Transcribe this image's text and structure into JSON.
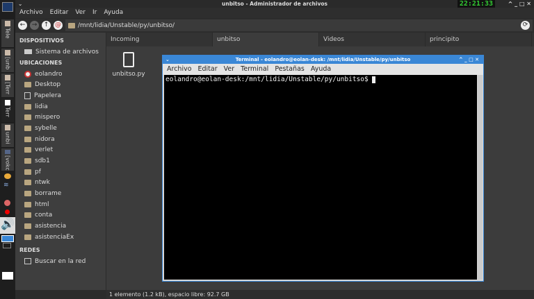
{
  "window": {
    "title": "unbitso - Administrador de archivos",
    "clock": "22:21:33"
  },
  "taskbar": {
    "items": [
      "Tele",
      "[unb",
      "[Terr",
      "Terr",
      "unbi",
      "[vokc"
    ]
  },
  "menu": [
    "Archivo",
    "Editar",
    "Ver",
    "Ir",
    "Ayuda"
  ],
  "toolbar": {
    "path": "/mnt/lidia/Unstable/py/unbitso/"
  },
  "sidebar": {
    "devices_title": "DISPOSITIVOS",
    "devices": [
      "Sistema de archivos"
    ],
    "places_title": "UBICACIONES",
    "places": [
      "eolandro",
      "Desktop",
      "Papelera",
      "lidia",
      "mispero",
      "sybelle",
      "nidora",
      "verlet",
      "sdb1",
      "pf",
      "ntwk",
      "borrame",
      "html",
      "conta",
      "asistencia",
      "asistenciaEx"
    ],
    "network_title": "REDES",
    "network": [
      "Buscar en la red"
    ]
  },
  "tabs": [
    "Incoming",
    "unbitso",
    "Videos",
    "principito"
  ],
  "files": [
    "unbitso.py"
  ],
  "status": "1 elemento (1.2 kB), espacio libre: 92.7 GB",
  "terminal": {
    "title": "Terminal - eolandro@eolan-desk: /mnt/lidia/Unstable/py/unbitso",
    "menu": [
      "Archivo",
      "Editar",
      "Ver",
      "Terminal",
      "Pestañas",
      "Ayuda"
    ],
    "prompt": "eolandro@eolan-desk:/mnt/lidia/Unstable/py/unbitso$ "
  }
}
